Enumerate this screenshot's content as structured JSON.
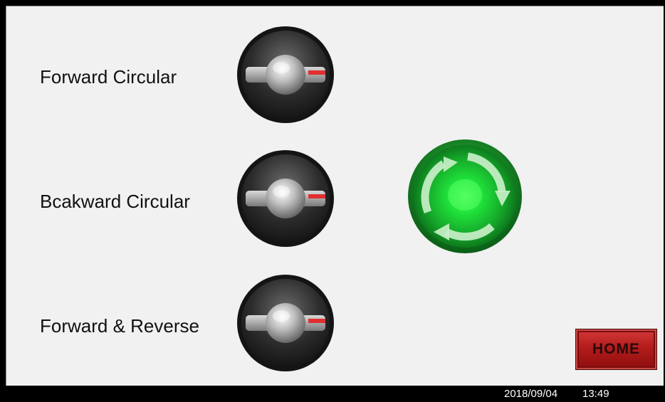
{
  "selectors": [
    {
      "label": "Forward Circular",
      "position": "right"
    },
    {
      "label": "Bcakward Circular",
      "position": "right"
    },
    {
      "label": "Forward & Reverse",
      "position": "right"
    }
  ],
  "run_indicator": {
    "state": "on",
    "color": "#19d12f",
    "icon": "rotate-arrows-icon"
  },
  "home_button": {
    "label": "HOME",
    "color": "#b31c1c"
  },
  "status_bar": {
    "date": "2018/09/04",
    "time": "13:49"
  }
}
